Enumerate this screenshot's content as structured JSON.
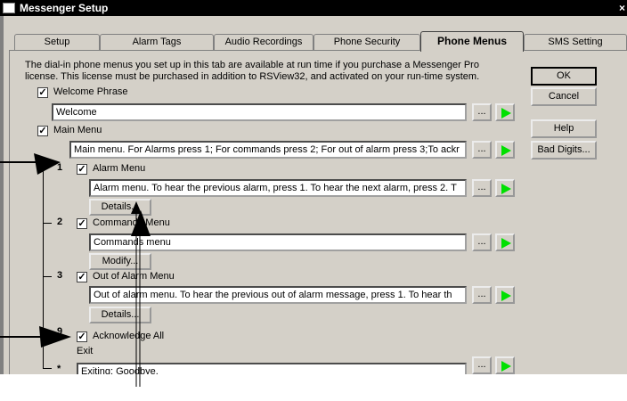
{
  "window": {
    "title": "Messenger Setup",
    "close_glyph": "×"
  },
  "tabs": [
    {
      "label": "Setup",
      "active": false
    },
    {
      "label": "Alarm Tags",
      "active": false
    },
    {
      "label": "Audio Recordings",
      "active": false
    },
    {
      "label": "Phone Security",
      "active": false
    },
    {
      "label": "Phone Menus",
      "active": true
    },
    {
      "label": "SMS Setting",
      "active": false
    }
  ],
  "description": {
    "line1": "The dial-in phone menus you set up in this tab are available at run time if you purchase a Messenger Pro",
    "line2": "license. This license must be purchased in addition to RSView32, and activated on your run-time system."
  },
  "buttons": {
    "ok": "OK",
    "cancel": "Cancel",
    "help": "Help",
    "bad_digits": "Bad Digits...",
    "browse": "...",
    "details": "Details...",
    "modify": "Modify..."
  },
  "welcome": {
    "label": "Welcome Phrase",
    "checked": true,
    "value": "Welcome"
  },
  "main_menu": {
    "label": "Main Menu",
    "checked": true,
    "value": "Main menu. For Alarms press 1; For commands press 2; For out of alarm press 3;To ackr"
  },
  "items": [
    {
      "number": "1",
      "label": "Alarm Menu",
      "checked": true,
      "value": "Alarm menu. To hear the previous alarm, press 1. To hear the next alarm, press 2. T"
    },
    {
      "number": "2",
      "label": "Commands Menu",
      "checked": true,
      "value": "Commands menu"
    },
    {
      "number": "3",
      "label": "Out of Alarm Menu",
      "checked": true,
      "value": "Out of alarm menu. To hear the previous out of alarm message, press 1. To hear th"
    }
  ],
  "acknowledge": {
    "number": "9",
    "label": "Acknowledge All",
    "checked": true
  },
  "exit": {
    "label": "Exit",
    "number": "*",
    "value": "Exiting; Goodbye."
  },
  "check_glyph": "✓"
}
